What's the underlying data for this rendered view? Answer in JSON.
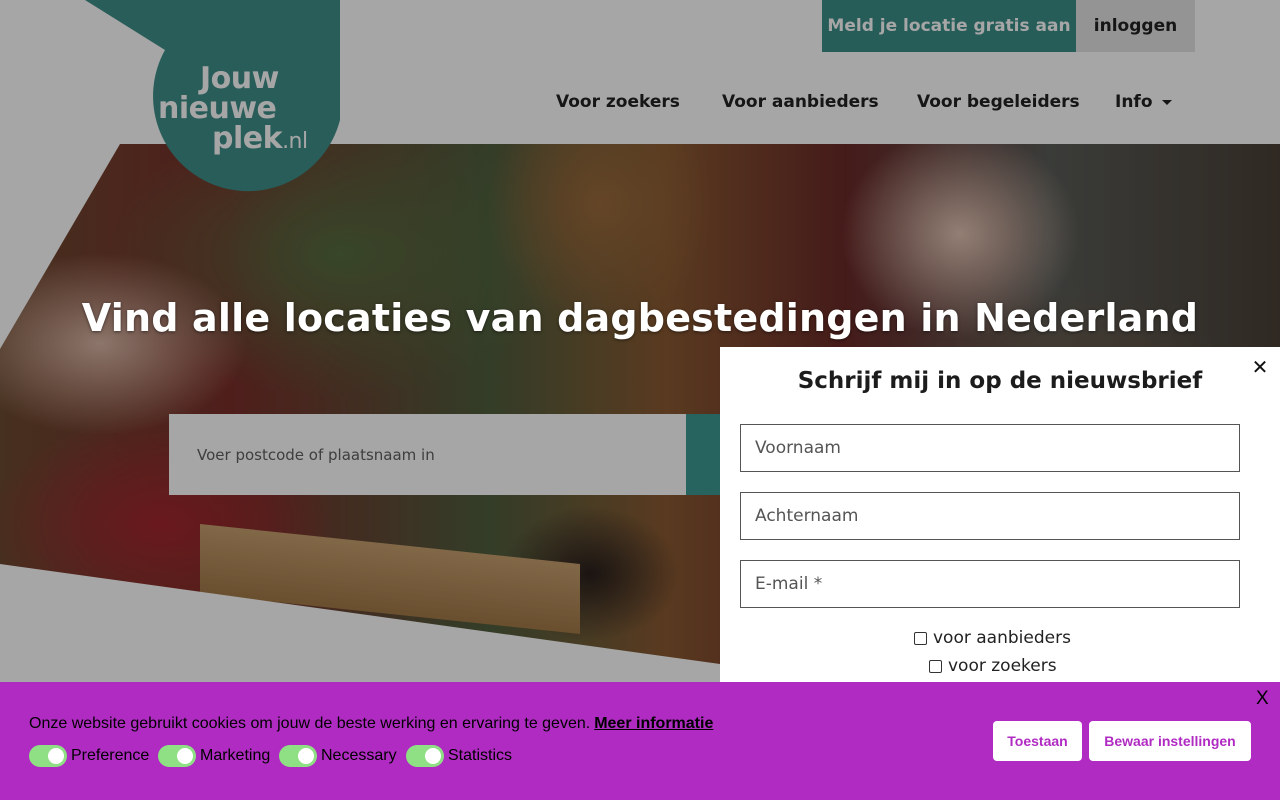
{
  "header": {
    "logo": {
      "line1": "Jouw",
      "line2": "nieuwe",
      "line3": "plek",
      "suffix": ".nl"
    },
    "cta_label": "Meld je locatie gratis aan",
    "login_label": "inloggen",
    "nav": [
      {
        "label": "Voor zoekers"
      },
      {
        "label": "Voor aanbieders"
      },
      {
        "label": "Voor begeleiders"
      },
      {
        "label": "Info"
      }
    ],
    "brand_color": "#3d8f89"
  },
  "hero": {
    "title": "Vind alle locaties van dagbestedingen in Nederland",
    "search_placeholder": "Voer postcode of plaatsnaam in"
  },
  "newsletter": {
    "title": "Schrijf mij in op de nieuwsbrief",
    "close_label": "✕",
    "fields": {
      "first_name": "Voornaam",
      "last_name": "Achternaam",
      "email": "E-mail *"
    },
    "checkboxes": [
      {
        "label": "voor aanbieders",
        "checked": false
      },
      {
        "label": "voor zoekers",
        "checked": false
      }
    ]
  },
  "cookie": {
    "message": "Onze website gebruikt cookies om jouw de beste werking en ervaring te geven.",
    "more_info": "Meer informatie",
    "close_label": "X",
    "toggles": [
      {
        "label": "Preference",
        "on": true
      },
      {
        "label": "Marketing",
        "on": true
      },
      {
        "label": "Necessary",
        "on": true
      },
      {
        "label": "Statistics",
        "on": true
      }
    ],
    "accept_label": "Toestaan",
    "save_label": "Bewaar instellingen",
    "bg_color": "#b02bc2"
  }
}
